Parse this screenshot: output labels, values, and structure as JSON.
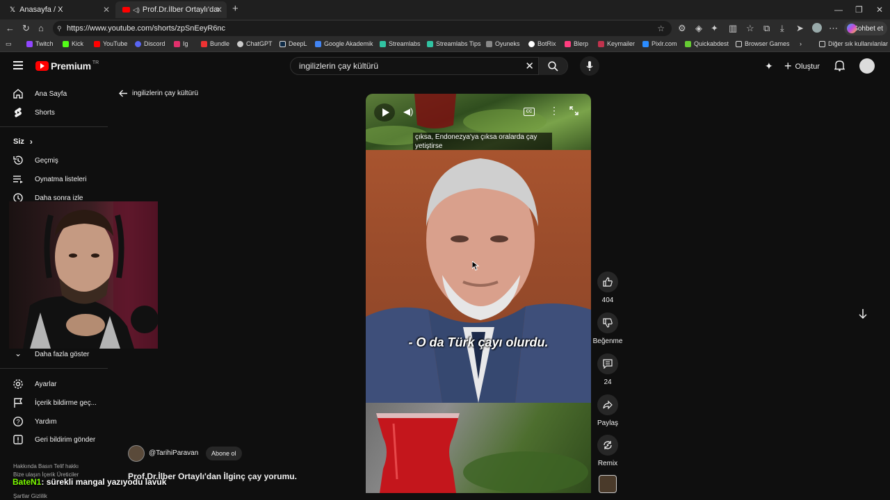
{
  "browser": {
    "tabs": [
      {
        "label": "Anasayfa / X"
      },
      {
        "label": "Prof.Dr.İlber Ortaylı'dan İlginç"
      }
    ],
    "new_tab": "+",
    "url": "https://www.youtube.com/shorts/zpSnEeyR6nc",
    "chat_button": "Sohbet et",
    "bookmarks": [
      "Twitch",
      "Kick",
      "YouTube",
      "Discord",
      "Ig",
      "Bundle",
      "ChatGPT",
      "DeepL",
      "Google Akademik",
      "Streamlabs",
      "Streamlabs Tips",
      "Oyuneks",
      "BotRix",
      "Blerp",
      "Keymailer",
      "Pixlr.com",
      "Quickabdest",
      "Browser Games"
    ],
    "other_bookmarks": "Diğer sık kullanılanlar"
  },
  "yt": {
    "logo": "Premium",
    "logo_region": "TR",
    "search_value": "ingilizlerin çay kültürü",
    "create_label": "Oluştur",
    "back_label": "ingilizlerin çay kültürü"
  },
  "sidebar": {
    "home": "Ana Sayfa",
    "shorts": "Shorts",
    "you": "Siz",
    "history": "Geçmiş",
    "playlists": "Oynatma listeleri",
    "watch_later": "Daha sonra izle",
    "show_more": "Daha fazla göster",
    "settings": "Ayarlar",
    "report_history": "İçerik bildirme geç...",
    "help": "Yardım",
    "feedback": "Geri bildirim gönder",
    "footer1": "Hakkında   Basın   Telif hakkı",
    "footer2": "Bize ulaşın   İçerik Üreticiler",
    "footer3": "Şartlar   Gizlilik"
  },
  "video": {
    "caption_top": "çıksa, Endonezya'ya çıksa oralarda çay yetiştirse",
    "subtitle": "- O da Türk çayı olurdu.",
    "channel": "@TarihiParavan",
    "subscribe": "Abone ol",
    "title": "Prof.Dr.İlber Ortaylı'dan İlginç çay yorumu.",
    "cc": "CC"
  },
  "actions": {
    "likes": "404",
    "dislike": "Beğenme",
    "comments": "24",
    "share": "Paylaş",
    "remix": "Remix"
  },
  "stream_chat": {
    "user": "BateN1",
    "message": ": sürekli mangal yazıyodu lavuk"
  }
}
